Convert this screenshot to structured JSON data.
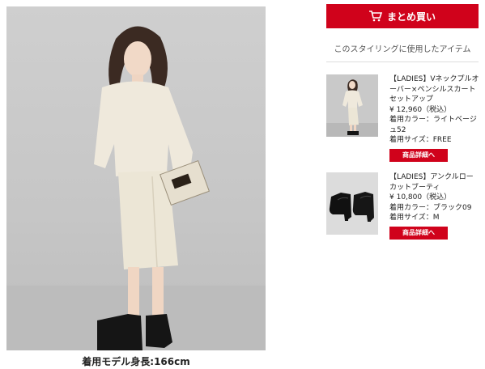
{
  "main": {
    "model_height": "着用モデル身長:166cm"
  },
  "sidebar": {
    "buy_button_label": "まとめ買い",
    "styling_heading": "このスタイリングに使用したアイテム",
    "items": [
      {
        "name": "【LADIES】Vネックプルオーバー×ペンシルスカートセットアップ",
        "price": "¥ 12,960（税込）",
        "color": "着用カラー：ライトベージュ52",
        "size": "着用サイズ：FREE",
        "detail_label": "商品詳細へ",
        "thumb_icon": "model-photo-thumbnail"
      },
      {
        "name": "【LADIES】アンクルローカットブーティ",
        "price": "¥ 10,800（税込）",
        "color": "着用カラー：ブラック09",
        "size": "着用サイズ：M",
        "detail_label": "商品詳細へ",
        "thumb_icon": "bootie-thumbnail"
      }
    ]
  },
  "colors": {
    "accent": "#d0021b",
    "photo_bg": "#c8c8c8",
    "outfit": "#ede7d8"
  }
}
